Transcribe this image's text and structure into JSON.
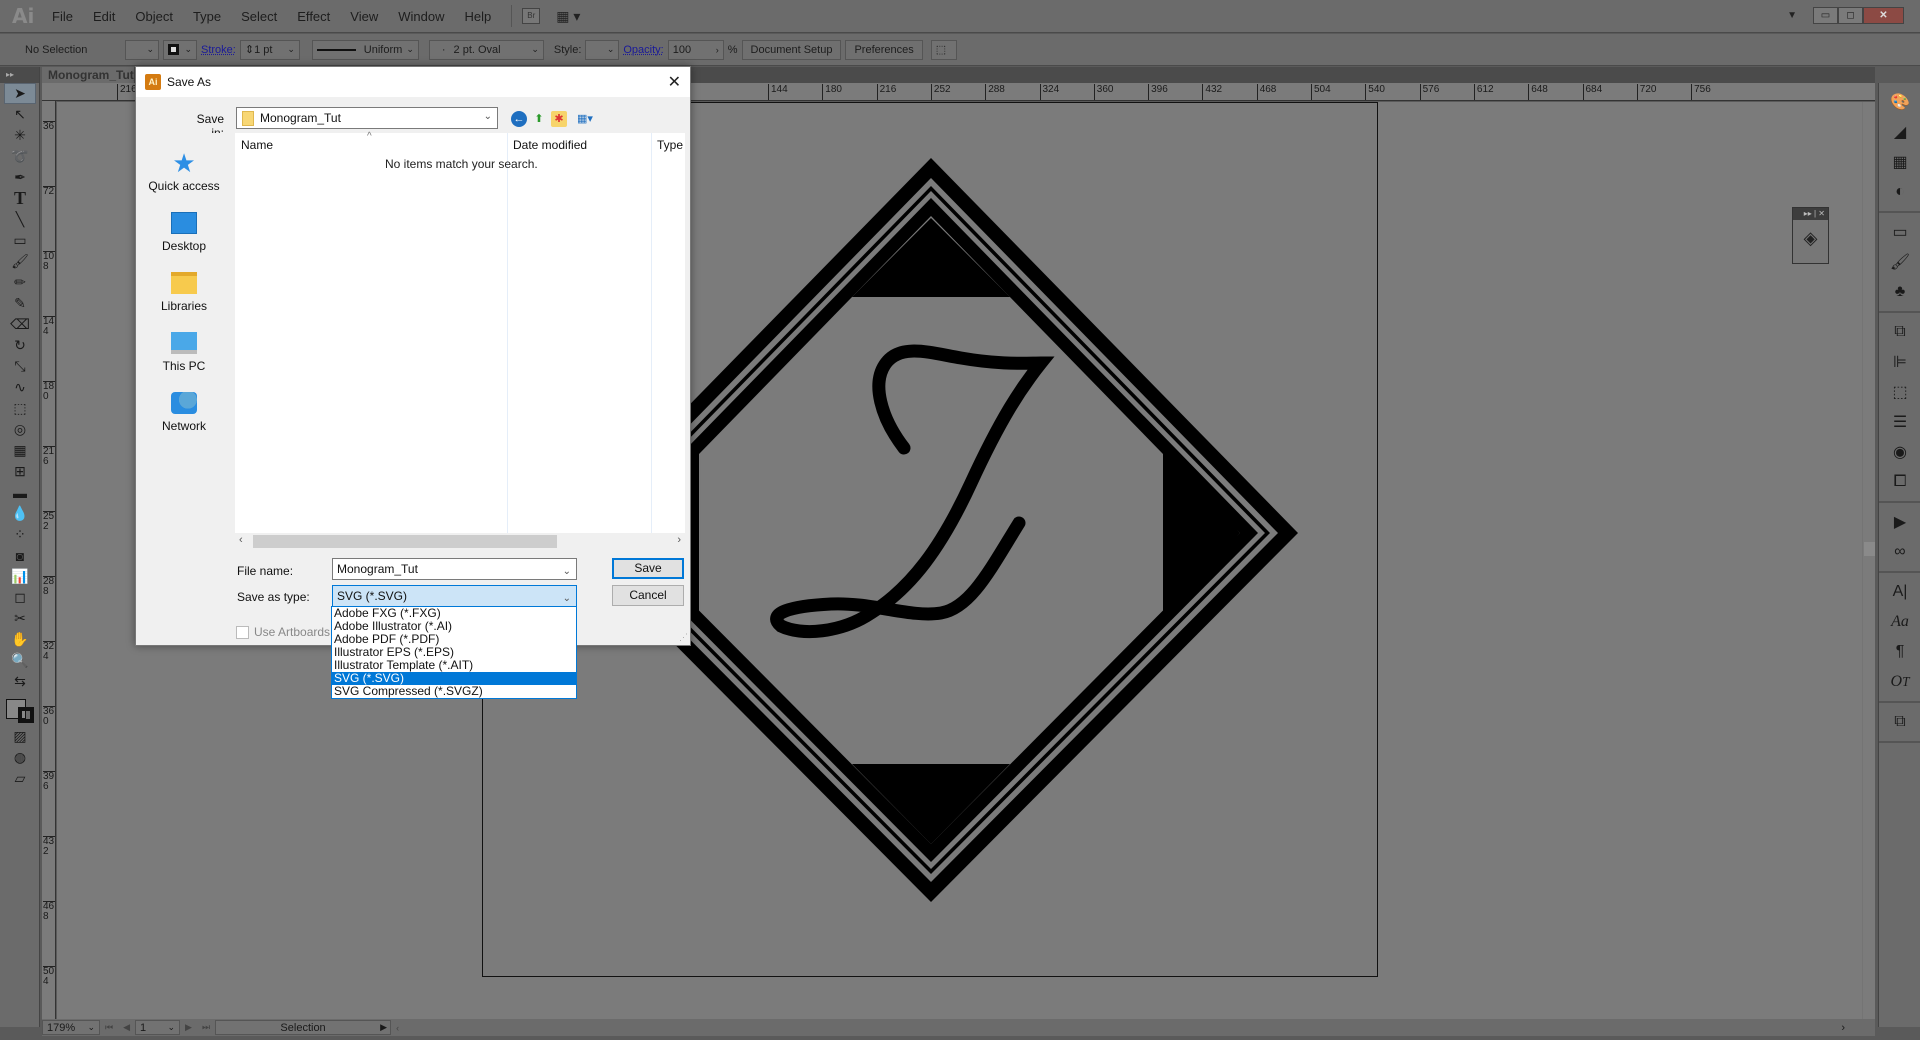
{
  "app": {
    "logo": "Ai",
    "document_tab": "Monogram_Tut_"
  },
  "menu": [
    "File",
    "Edit",
    "Object",
    "Type",
    "Select",
    "Effect",
    "View",
    "Window",
    "Help"
  ],
  "menu_extras": {
    "bridge": "Br",
    "workspace_arrow": "▾"
  },
  "control_bar": {
    "selection": "No Selection",
    "stroke_label": "Stroke:",
    "stroke_weight": "1 pt",
    "profile": "Uniform",
    "brush": "2 pt. Oval",
    "style_label": "Style:",
    "opacity_label": "Opacity:",
    "opacity_value": "100",
    "opacity_unit": "%",
    "document_setup": "Document Setup",
    "preferences": "Preferences"
  },
  "rulers": {
    "top": [
      "216",
      "144",
      "180",
      "216",
      "252",
      "288",
      "324",
      "360",
      "396",
      "432",
      "468",
      "504",
      "540",
      "576",
      "612",
      "648",
      "684",
      "720",
      "756"
    ],
    "left": [
      "36",
      "72",
      "108",
      "144",
      "180",
      "216",
      "252",
      "288",
      "324",
      "360",
      "396",
      "432",
      "468",
      "504"
    ]
  },
  "status": {
    "zoom": "179%",
    "artboard": "1",
    "tool": "Selection"
  },
  "dialog": {
    "title": "Save As",
    "save_in_label": "Save in:",
    "save_in_value": "Monogram_Tut",
    "places": [
      {
        "label": "Quick access",
        "icon": "quick-access-icon"
      },
      {
        "label": "Desktop",
        "icon": "desktop-icon"
      },
      {
        "label": "Libraries",
        "icon": "libraries-icon"
      },
      {
        "label": "This PC",
        "icon": "this-pc-icon"
      },
      {
        "label": "Network",
        "icon": "network-icon"
      }
    ],
    "columns": [
      "Name",
      "Date modified",
      "Type"
    ],
    "empty_message": "No items match your search.",
    "file_name_label": "File name:",
    "file_name_value": "Monogram_Tut",
    "save_as_type_label": "Save as type:",
    "save_as_type_value": "SVG (*.SVG)",
    "use_artboards": "Use Artboards",
    "save_button": "Save",
    "cancel_button": "Cancel",
    "type_options": [
      "Adobe FXG (*.FXG)",
      "Adobe Illustrator (*.AI)",
      "Adobe PDF (*.PDF)",
      "Illustrator EPS (*.EPS)",
      "Illustrator Template (*.AIT)",
      "SVG (*.SVG)",
      "SVG Compressed (*.SVGZ)"
    ],
    "selected_type_index": 5
  },
  "colors": {
    "accent": "#0078d7",
    "canvas": "#7b7b7b",
    "chrome": "#6b6b6b"
  }
}
